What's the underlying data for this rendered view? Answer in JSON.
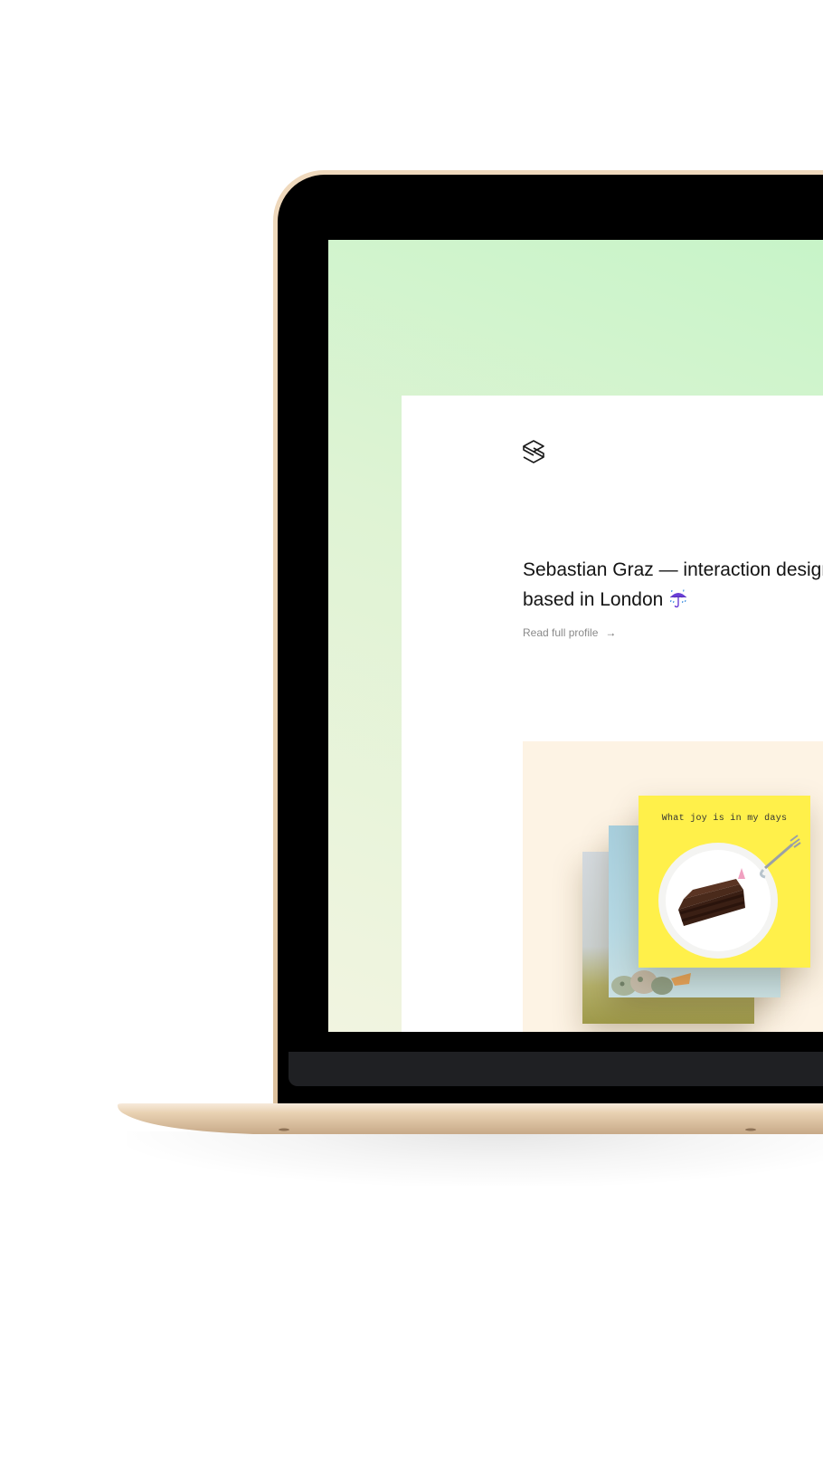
{
  "site": {
    "logo_icon": "s-monogram-logo",
    "intro_line_1": "Sebastian Graz — interaction designer",
    "intro_line_2": "based in London",
    "intro_emoji": "umbrella-with-rain-icon",
    "profile_link": "Read full profile",
    "profile_arrow": "→"
  },
  "featured": {
    "caption": "What joy is in my days",
    "image": "chocolate-cake-on-plate"
  },
  "colors": {
    "screen_bg_top": "#c7f4c8",
    "screen_bg_bottom": "#f1f4e0",
    "card_area_bg": "#fdf3e4",
    "front_card_bg": "#fff04a",
    "laptop_gold": "#e7cfae",
    "bezel": "#000000"
  }
}
